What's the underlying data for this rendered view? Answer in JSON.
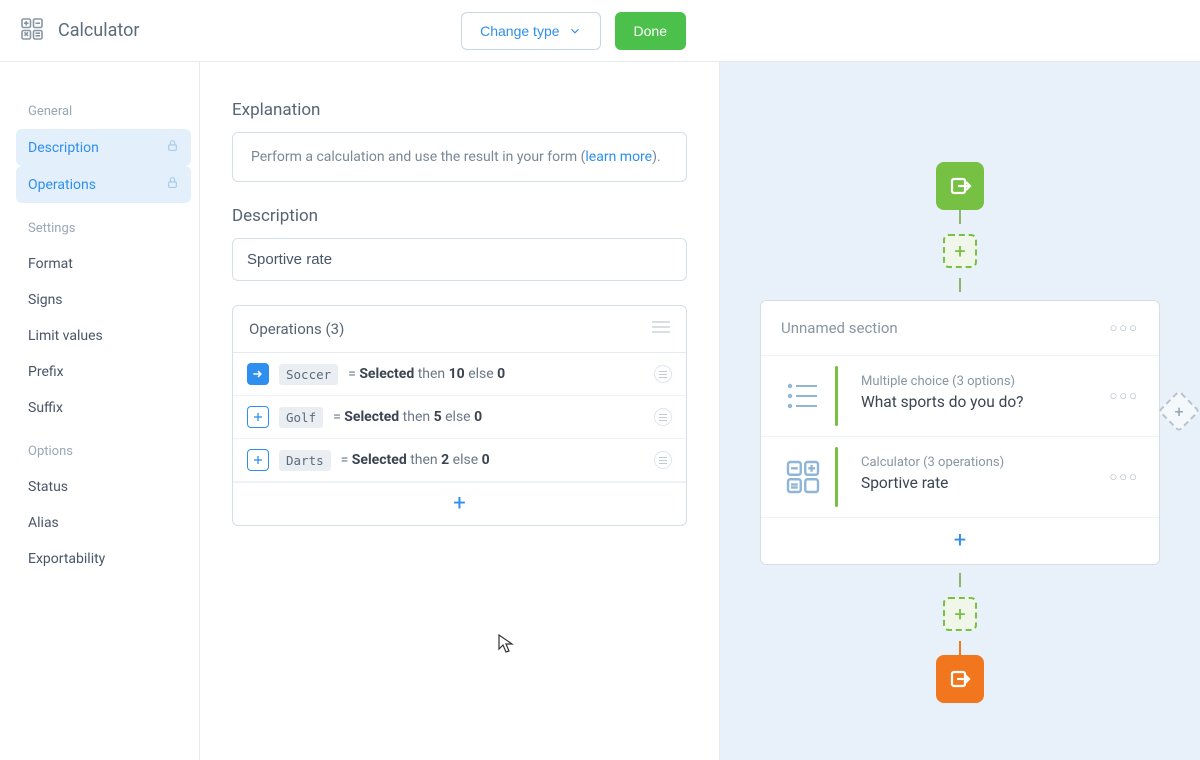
{
  "header": {
    "title": "Calculator",
    "change_type": "Change type",
    "done": "Done"
  },
  "sidebar": {
    "groups": [
      {
        "title": "General",
        "items": [
          {
            "label": "Description",
            "active": true,
            "locked": true
          },
          {
            "label": "Operations",
            "active": true,
            "locked": true
          }
        ]
      },
      {
        "title": "Settings",
        "items": [
          {
            "label": "Format"
          },
          {
            "label": "Signs"
          },
          {
            "label": "Limit values"
          },
          {
            "label": "Prefix"
          },
          {
            "label": "Suffix"
          }
        ]
      },
      {
        "title": "Options",
        "items": [
          {
            "label": "Status"
          },
          {
            "label": "Alias"
          },
          {
            "label": "Exportability"
          }
        ]
      }
    ]
  },
  "main": {
    "explanation_title": "Explanation",
    "explanation_text": "Perform a calculation and use the result in your form (",
    "explanation_link": "learn more",
    "explanation_tail": ").",
    "description_title": "Description",
    "description_value": "Sportive rate",
    "operations_title": "Operations (3)",
    "operations": [
      {
        "icon": "arrow",
        "tag": "Soccer",
        "eq": " = ",
        "sel": "Selected",
        "then": " then ",
        "thenVal": "10",
        "else": " else ",
        "elseVal": "0"
      },
      {
        "icon": "plus",
        "tag": "Golf",
        "eq": " = ",
        "sel": "Selected",
        "then": " then ",
        "thenVal": "5",
        "else": " else ",
        "elseVal": "0"
      },
      {
        "icon": "plus",
        "tag": "Darts",
        "eq": " = ",
        "sel": "Selected",
        "then": " then ",
        "thenVal": "2",
        "else": " else ",
        "elseVal": "0"
      }
    ]
  },
  "preview": {
    "section_title": "Unnamed section",
    "blocks": [
      {
        "type_label": "Multiple choice (3 options)",
        "title": "What sports do you do?",
        "icon": "list"
      },
      {
        "type_label": "Calculator (3 operations)",
        "title": "Sportive rate",
        "icon": "calc"
      }
    ]
  }
}
